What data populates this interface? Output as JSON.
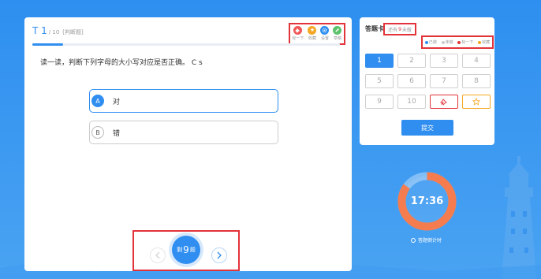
{
  "question": {
    "number": "T 1",
    "total": "/ 10",
    "type": "[判断题]",
    "progress": 0.1,
    "text": "读一读，判断下列字母的大小写对应是否正确。 C  s",
    "options": [
      {
        "letter": "A",
        "text": "对",
        "selected": true
      },
      {
        "letter": "B",
        "text": "错",
        "selected": false
      }
    ]
  },
  "tools": [
    {
      "label": "标一下",
      "icon": "pin-icon",
      "color": "#f05454"
    },
    {
      "label": "收藏",
      "icon": "star-icon",
      "color": "#f5a623"
    },
    {
      "label": "设置",
      "icon": "gear-icon",
      "color": "#2f8ef0"
    },
    {
      "label": "草稿",
      "icon": "pencil-icon",
      "color": "#5cc26b"
    }
  ],
  "nav": {
    "remaining_prefix": "剩",
    "remaining_count": "9",
    "remaining_suffix": "题"
  },
  "card": {
    "title": "答题卡",
    "remaining_prefix": "还有",
    "remaining_count": "9",
    "remaining_suffix": "未做",
    "legend": [
      {
        "label": "已做",
        "color": "#2f8ef0"
      },
      {
        "label": "未做",
        "color": "#cccccc"
      },
      {
        "label": "标一下",
        "color": "#e2333a"
      },
      {
        "label": "收藏",
        "color": "#f5a623"
      }
    ],
    "cells": [
      {
        "label": "1",
        "state": "current"
      },
      {
        "label": "2",
        "state": "normal"
      },
      {
        "label": "3",
        "state": "normal"
      },
      {
        "label": "4",
        "state": "normal"
      },
      {
        "label": "5",
        "state": "normal"
      },
      {
        "label": "6",
        "state": "normal"
      },
      {
        "label": "7",
        "state": "normal"
      },
      {
        "label": "8",
        "state": "normal"
      },
      {
        "label": "9",
        "state": "normal"
      },
      {
        "label": "10",
        "state": "normal"
      },
      {
        "label": "",
        "state": "tag",
        "icon": "pin-icon"
      },
      {
        "label": "",
        "state": "star",
        "icon": "star-icon"
      }
    ],
    "submit": "提交"
  },
  "timer": {
    "time": "17:36",
    "label": "答题倒计时",
    "ring_color": "#f47c4e",
    "ring_fraction": 0.85
  }
}
